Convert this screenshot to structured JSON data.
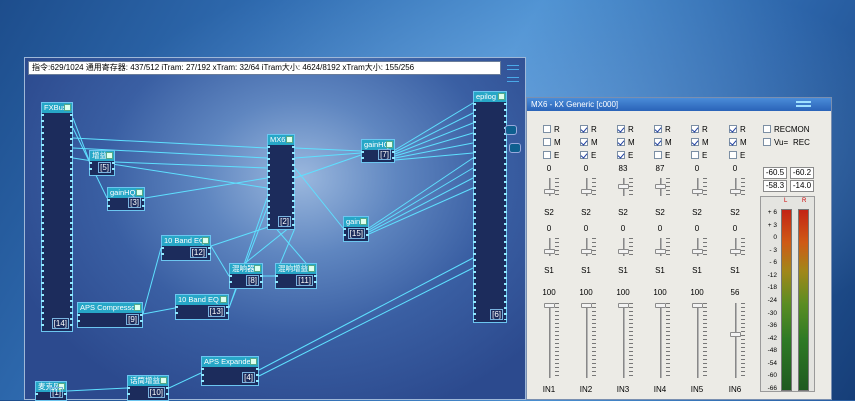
{
  "dsp_window": {
    "status": "指令:629/1024 通用寄存器: 437/512 iTram: 27/192 xTram: 32/64 iTram大小: 4624/8192 xTram大小: 155/256",
    "plugins": [
      {
        "label": "FXBusX",
        "num": "[14]"
      },
      {
        "label": "增益",
        "num": "[5]"
      },
      {
        "label": "gainHQ",
        "num": "[3]"
      },
      {
        "label": "MX6",
        "num": "[2]"
      },
      {
        "label": "gainHQ",
        "num": "[7]"
      },
      {
        "label": "gain",
        "num": "[15]"
      },
      {
        "label": "epilog",
        "num": "[6]"
      },
      {
        "label": "10 Band EQ",
        "num": "[12]"
      },
      {
        "label": "混响器",
        "num": "[8]"
      },
      {
        "label": "混响增益",
        "num": "[11]"
      },
      {
        "label": "10 Band EQ",
        "num": "[13]"
      },
      {
        "label": "APS Compressor",
        "num": "[9]"
      },
      {
        "label": "APS Expander",
        "num": "[4]"
      },
      {
        "label": "话筒增益",
        "num": "[10]"
      },
      {
        "label": "麦克风",
        "num": "[1]"
      }
    ]
  },
  "mixer_window": {
    "title": "MX6 - kX Generic [c000]",
    "channels": [
      {
        "r": false,
        "m": false,
        "e": false,
        "top": "0",
        "mid": "0",
        "bottom": "100",
        "s1": "S2",
        "s2": "S1",
        "name": "IN1"
      },
      {
        "r": true,
        "m": true,
        "e": true,
        "top": "0",
        "mid": "0",
        "bottom": "100",
        "s1": "S2",
        "s2": "S1",
        "name": "IN2"
      },
      {
        "r": true,
        "m": true,
        "e": true,
        "top": "83",
        "mid": "0",
        "bottom": "100",
        "s1": "S2",
        "s2": "S1",
        "name": "IN3"
      },
      {
        "r": true,
        "m": true,
        "e": false,
        "top": "87",
        "mid": "0",
        "bottom": "100",
        "s1": "S2",
        "s2": "S1",
        "name": "IN4"
      },
      {
        "r": true,
        "m": true,
        "e": false,
        "top": "0",
        "mid": "0",
        "bottom": "100",
        "s1": "S2",
        "s2": "S1",
        "name": "IN5"
      },
      {
        "r": true,
        "m": true,
        "e": false,
        "top": "0",
        "mid": "0",
        "bottom": "56",
        "s1": "S2",
        "s2": "S1",
        "name": "IN6"
      }
    ],
    "check_labels": {
      "r": "R",
      "m": "M",
      "e": "E"
    },
    "recmon": "RECMON",
    "vu": "Vu=",
    "rec": "REC",
    "peaks": [
      "-60.5",
      "-60.2",
      "-58.3",
      "-14.0"
    ],
    "meter_l": "L",
    "meter_r": "R",
    "meter_levels": [
      0.0,
      0.0
    ],
    "scale": [
      "+ 6",
      "+ 3",
      "0",
      "- 3",
      "- 6",
      "-12",
      "-18",
      "-24",
      "-30",
      "-36",
      "-42",
      "-48",
      "-54",
      "-60",
      "-66"
    ]
  },
  "colors": {
    "accent": "#27a7c7",
    "wire": "#5ee0ff",
    "titlebar": "#2a63b8"
  }
}
